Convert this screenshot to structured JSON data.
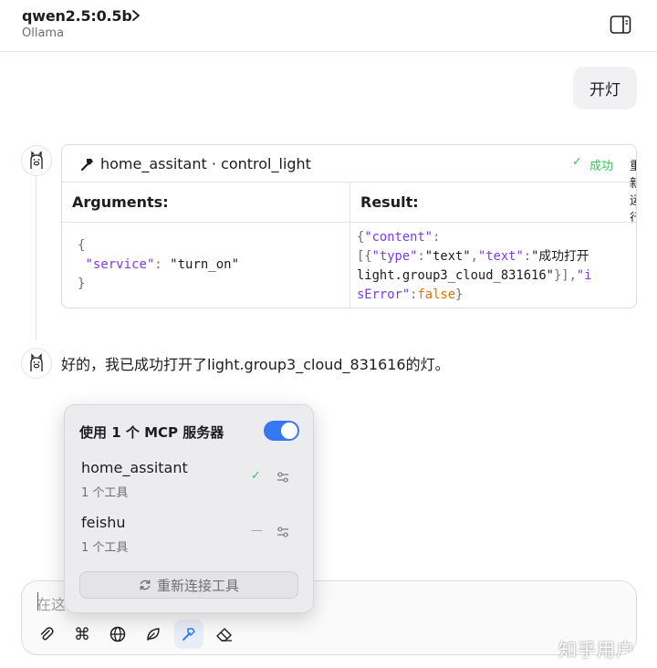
{
  "header": {
    "model_name": "qwen2.5:0.5b",
    "chevron_icon": "chevron-right-icon",
    "provider": "Ollama",
    "sidebar_icon": "sidebar-toggle-icon"
  },
  "user_message": {
    "text": "开灯"
  },
  "tool_call": {
    "title": "home_assitant · control_light",
    "status_icon": "check-icon",
    "status_label": "成功",
    "status_color": "#34c759",
    "rerun_label": "重新运行",
    "arguments_label": "Arguments:",
    "result_label": "Result:",
    "arguments": {
      "open": "{",
      "key": "\"service\"",
      "colon": ": ",
      "value": "\"turn_on\"",
      "close": "}"
    },
    "result": {
      "l1_open": "{",
      "l1_key": "\"content\"",
      "l1_colon": ":",
      "l2_a": "[{",
      "l2_type_key": "\"type\"",
      "l2_c1": ":",
      "l2_type_val": "\"text\"",
      "l2_comma": ",",
      "l2_text_key": "\"text\"",
      "l2_c2": ":",
      "l2_text_val": "\"成功打开",
      "l3_text": "light.group3_cloud_831616\"",
      "l3_close": "}],",
      "l3_iserr": "\"i",
      "l4_iserr": "sError\"",
      "l4_colon": ":",
      "l4_false": "false",
      "l4_close": "}"
    }
  },
  "assistant_message": {
    "text": "好的，我已成功打开了light.group3_cloud_831616的灯。"
  },
  "mcp_popover": {
    "title": "使用 1 个 MCP 服务器",
    "toggle_on": true,
    "accent_color": "#3478f6",
    "servers": [
      {
        "name": "home_assitant",
        "tools": "1 个工具",
        "state_icon": "check-icon",
        "state": "✓",
        "settings_icon": "settings-sliders-icon"
      },
      {
        "name": "feishu",
        "tools": "1 个工具",
        "state_icon": "dash-icon",
        "state": "—",
        "settings_icon": "settings-sliders-icon"
      }
    ],
    "reconnect_label": "重新连接工具",
    "reconnect_icon": "refresh-icon"
  },
  "composer": {
    "placeholder_visible": "在这",
    "toolbar": [
      "paperclip-icon",
      "command-icon",
      "globe-icon",
      "leaf-icon",
      "hammer-icon",
      "eraser-icon"
    ]
  },
  "watermark": "知乎用户"
}
